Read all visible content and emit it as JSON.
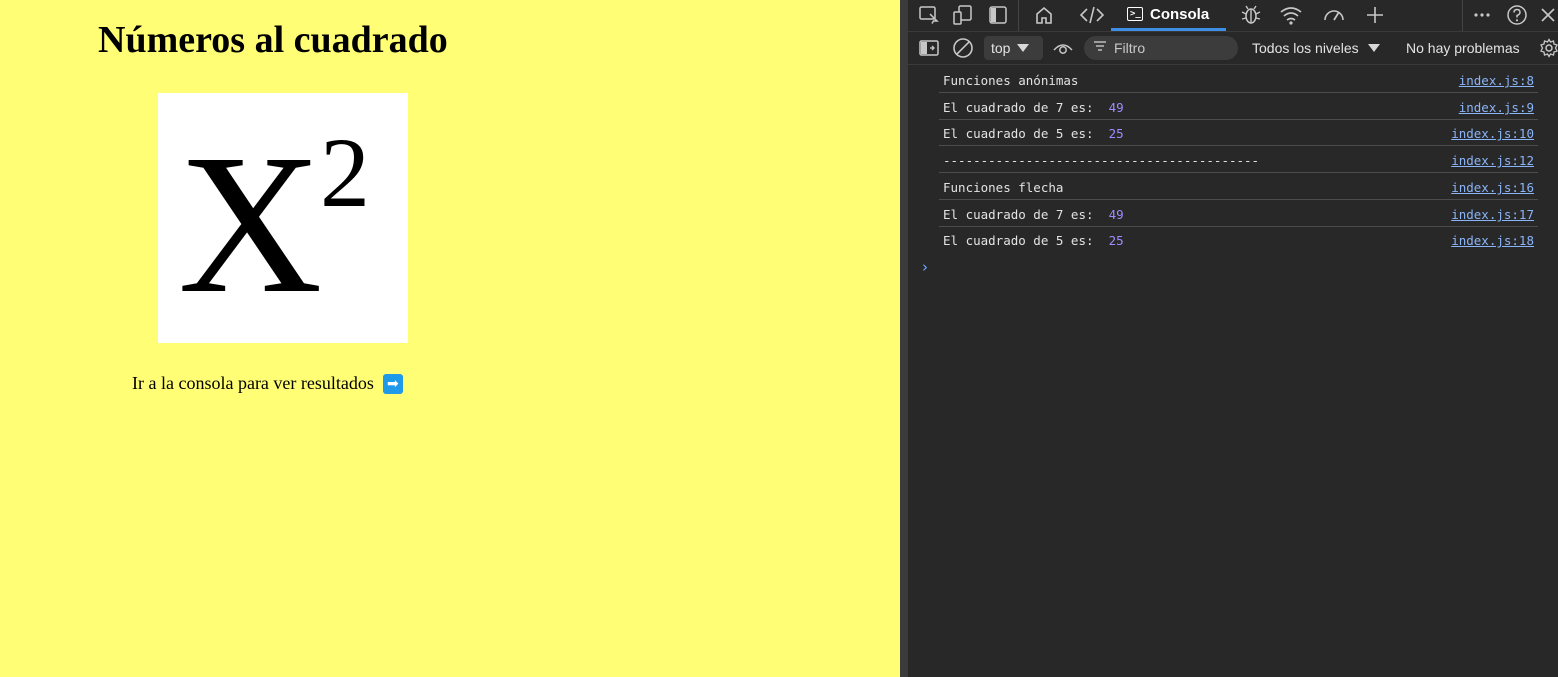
{
  "page": {
    "title": "Números al cuadrado",
    "image_base": "X",
    "image_exponent": "2",
    "hint_text": "Ir a la consola para ver resultados",
    "arrow_glyph": "➡",
    "background_color": "#fffe74"
  },
  "devtools": {
    "toolbar_icons": [
      "inspect-icon",
      "device-emulation-icon",
      "dock-panel-icon",
      "home-icon",
      "elements-icon",
      "console-icon",
      "sources-icon",
      "network-icon",
      "performance-icon",
      "add-tab-icon",
      "more-icon",
      "help-icon",
      "close-icon"
    ],
    "console_tab_label": "Consola",
    "context_selector_value": "top",
    "filter_placeholder": "Filtro",
    "levels_label": "Todos los niveles",
    "issues_label": "No hay problemas",
    "accent_color": "#3f8ee6",
    "number_color": "#9d8cff",
    "link_color": "#8ab4f8"
  },
  "console_rows": [
    {
      "text": "Funciones anónimas",
      "value": "",
      "source": "index.js:8"
    },
    {
      "text": "El cuadrado de 7 es:",
      "value": "49",
      "source": "index.js:9"
    },
    {
      "text": "El cuadrado de 5 es:",
      "value": "25",
      "source": "index.js:10"
    },
    {
      "text": "------------------------------------------",
      "value": "",
      "source": "index.js:12"
    },
    {
      "text": "Funciones flecha",
      "value": "",
      "source": "index.js:16"
    },
    {
      "text": "El cuadrado de 7 es:",
      "value": "49",
      "source": "index.js:17"
    },
    {
      "text": "El cuadrado de 5 es:",
      "value": "25",
      "source": "index.js:18"
    }
  ],
  "prompt_glyph": "›"
}
